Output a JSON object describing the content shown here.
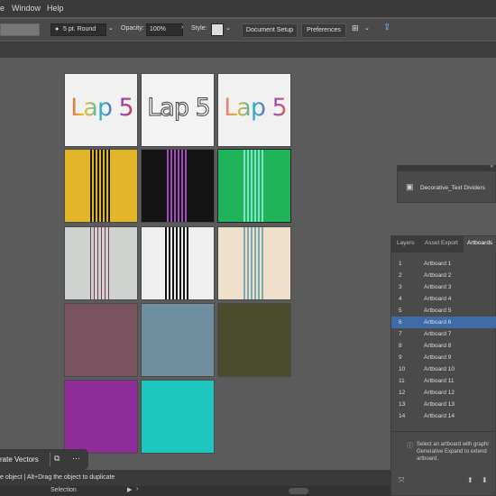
{
  "menubar": {
    "items": [
      "e",
      "Window",
      "Help"
    ]
  },
  "control": {
    "stroke_profile": "5 pt. Round",
    "opacity_label": "Opacity:",
    "opacity_value": "100%",
    "style_label": "Style:",
    "document_setup": "Document Setup",
    "preferences": "Preferences"
  },
  "library": {
    "name": "Decorative_Text Dividers"
  },
  "artpanel": {
    "tabs": [
      "Layers",
      "Asset Export",
      "Artboards"
    ],
    "active_tab": "Artboards",
    "rows": [
      {
        "num": "1",
        "name": "Artboard 1"
      },
      {
        "num": "2",
        "name": "Artboard 2"
      },
      {
        "num": "3",
        "name": "Artboard 3"
      },
      {
        "num": "4",
        "name": "Artboard 4"
      },
      {
        "num": "5",
        "name": "Artboard 5"
      },
      {
        "num": "6",
        "name": "Artboard 6"
      },
      {
        "num": "7",
        "name": "Artboard 7"
      },
      {
        "num": "8",
        "name": "Artboard 8"
      },
      {
        "num": "9",
        "name": "Artboard 9"
      },
      {
        "num": "10",
        "name": "Artboard 10"
      },
      {
        "num": "11",
        "name": "Artboard 11"
      },
      {
        "num": "12",
        "name": "Artboard 12"
      },
      {
        "num": "13",
        "name": "Artboard 13"
      },
      {
        "num": "14",
        "name": "Artboard 14"
      }
    ],
    "selected_row": "6",
    "info_text": "Select an artboard with graphi Generative Expand to extend artboard."
  },
  "canvas": {
    "lap_text": "Lap 5"
  },
  "floatbar": {
    "label": "rate Vectors"
  },
  "status": {
    "hint": "e object  |  Alt+Drag the object to duplicate",
    "tool": "Selection"
  },
  "colors": {
    "canvas": "#5b5b5b",
    "selection": "#3d6ca8",
    "yellow": "#e2b52a",
    "green": "#20b45a",
    "magenta": "#8e2d9a",
    "teal": "#1ec6c0"
  }
}
